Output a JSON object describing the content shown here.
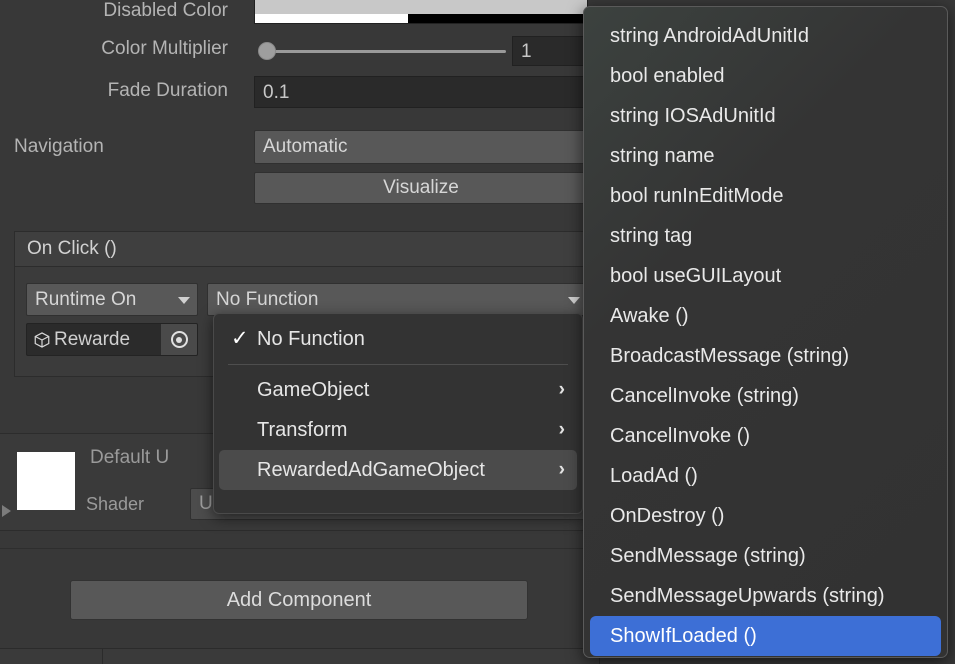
{
  "inspector": {
    "fields": [
      {
        "label": "Disabled Color",
        "type": "color"
      },
      {
        "label": "Color Multiplier",
        "type": "slider",
        "value": "1"
      },
      {
        "label": "Fade Duration",
        "type": "number",
        "value": "0.1"
      },
      {
        "label": "Navigation",
        "type": "popup",
        "value": "Automatic"
      }
    ],
    "visualize_button": "Visualize",
    "event": {
      "header": "On Click ()",
      "runtime_mode": "Runtime On",
      "function_value": "No Function",
      "object_name": "Rewarde",
      "object_icon": "cube-icon",
      "picker_icon": "target-picker-icon"
    },
    "material": {
      "name": "Default U",
      "shader_label": "Shader",
      "shader_value": "U"
    },
    "add_component_button": "Add Component"
  },
  "function_menu": {
    "items": [
      {
        "label": "No Function",
        "checked": true,
        "submenu": false,
        "selected": false
      },
      {
        "label": "GameObject",
        "checked": false,
        "submenu": true,
        "selected": false
      },
      {
        "label": "Transform",
        "checked": false,
        "submenu": true,
        "selected": false
      },
      {
        "label": "RewardedAdGameObject",
        "checked": false,
        "submenu": true,
        "selected": true
      }
    ],
    "check_glyph": "✓",
    "arrow_glyph": "›"
  },
  "member_submenu": {
    "items": [
      {
        "label": "string AndroidAdUnitId",
        "highlighted": false
      },
      {
        "label": "bool enabled",
        "highlighted": false
      },
      {
        "label": "string IOSAdUnitId",
        "highlighted": false
      },
      {
        "label": "string name",
        "highlighted": false
      },
      {
        "label": "bool runInEditMode",
        "highlighted": false
      },
      {
        "label": "string tag",
        "highlighted": false
      },
      {
        "label": "bool useGUILayout",
        "highlighted": false
      },
      {
        "label": "Awake ()",
        "highlighted": false
      },
      {
        "label": "BroadcastMessage (string)",
        "highlighted": false
      },
      {
        "label": "CancelInvoke (string)",
        "highlighted": false
      },
      {
        "label": "CancelInvoke ()",
        "highlighted": false
      },
      {
        "label": "LoadAd ()",
        "highlighted": false
      },
      {
        "label": "OnDestroy ()",
        "highlighted": false
      },
      {
        "label": "SendMessage (string)",
        "highlighted": false
      },
      {
        "label": "SendMessageUpwards (string)",
        "highlighted": false
      },
      {
        "label": "ShowIfLoaded ()",
        "highlighted": true
      }
    ]
  },
  "colors": {
    "accent": "#3d6fd6",
    "panel_bg": "#383838",
    "menu_bg": "#333333",
    "text": "#e6e6e6"
  }
}
